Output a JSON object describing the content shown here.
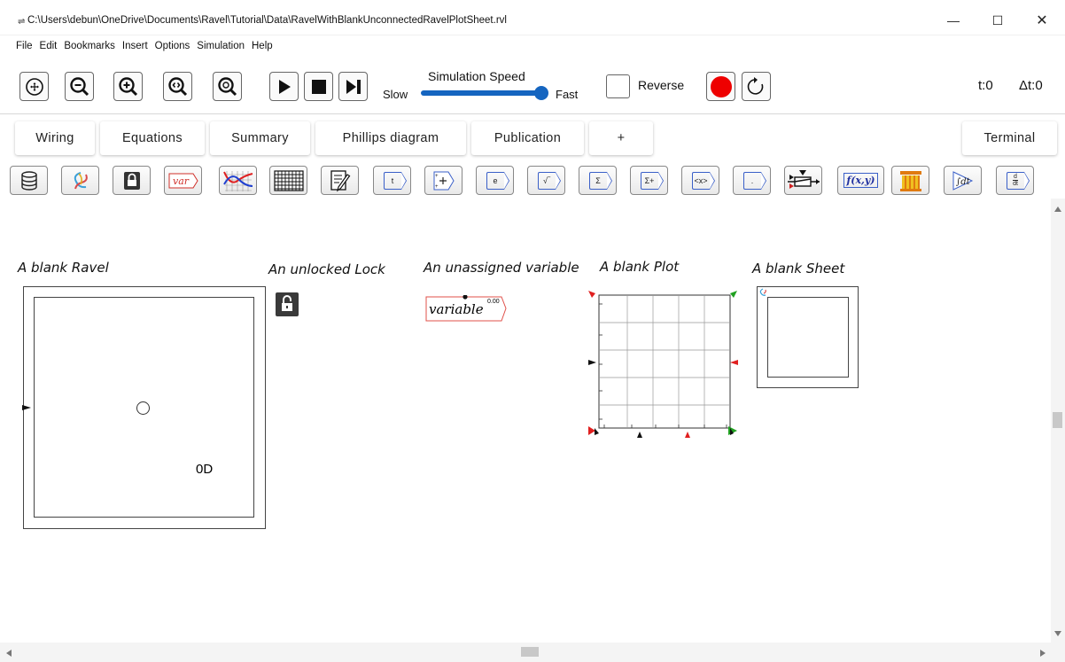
{
  "window": {
    "title": "C:\\Users\\debun\\OneDrive\\Documents\\Ravel\\Tutorial\\Data\\RavelWithBlankUnconnectedRavelPlotSheet.rvl",
    "minimize": "—",
    "maximize": "☐",
    "close": "✕"
  },
  "menu": [
    "File",
    "Edit",
    "Bookmarks",
    "Insert",
    "Options",
    "Simulation",
    "Help"
  ],
  "toolbar": {
    "speed_title": "Simulation Speed",
    "slow": "Slow",
    "fast": "Fast",
    "reverse": "Reverse",
    "time": "t:0",
    "delta": "Δt:0",
    "record_color": "#ee0000"
  },
  "tabs": [
    "Wiring",
    "Equations",
    "Summary",
    "Phillips diagram",
    "Publication",
    "+",
    "Terminal"
  ],
  "palette": {
    "var_label": "var",
    "time_label": "t",
    "e_label": "e",
    "sum_label": "Σ",
    "sumplus_label": "Σ+",
    "mean_label": "<x>",
    "dot_label": ".",
    "fxy_label": "f(x,y)",
    "integ_label": "∫dt",
    "deriv_top": "d",
    "deriv_bot": "dt"
  },
  "canvas": {
    "ravel_caption": "A blank Ravel",
    "lock_caption": "An unlocked Lock",
    "variable_caption": "An unassigned variable",
    "plot_caption": "A blank Plot",
    "sheet_caption": "A blank Sheet",
    "variable_name": "variable",
    "variable_value": "0.00",
    "ravel_rank": "0D"
  }
}
